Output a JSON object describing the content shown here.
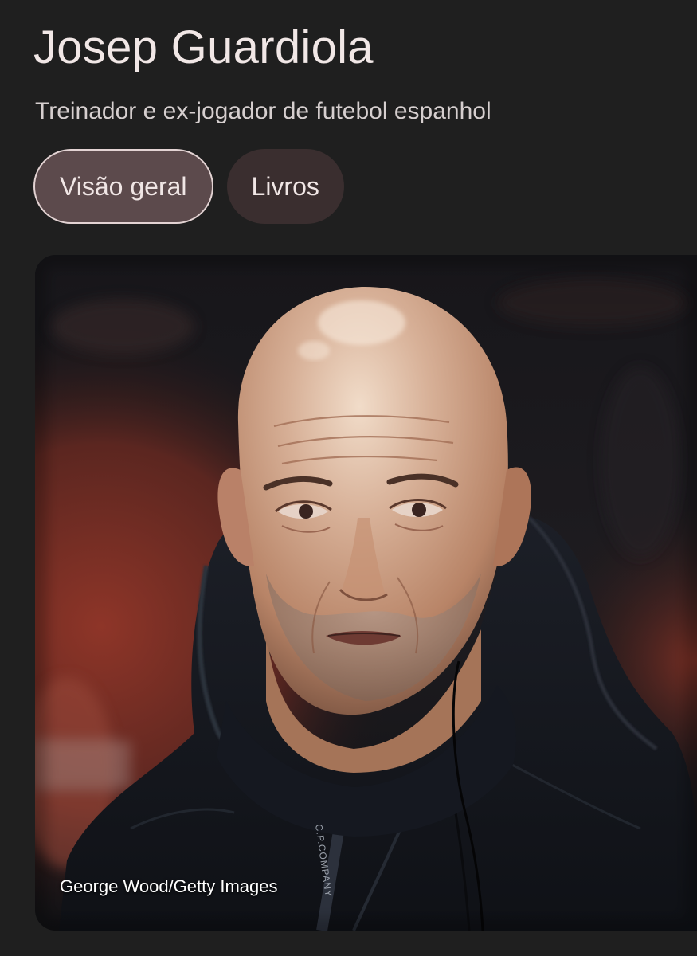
{
  "header": {
    "title": "Josep Guardiola",
    "subtitle": "Treinador e ex-jogador de futebol espanhol"
  },
  "tabs": [
    {
      "label": "Visão geral",
      "selected": true
    },
    {
      "label": "Livros",
      "selected": false
    }
  ],
  "photo": {
    "credit": "George Wood/Getty Images",
    "jacket_lettering": "C.P.COMPANY"
  },
  "colors": {
    "background": "#1f1f1f",
    "tab_selected_bg": "#5c4a4c",
    "tab_bg": "#3a2e2f",
    "text_primary": "#f1e7e6"
  }
}
